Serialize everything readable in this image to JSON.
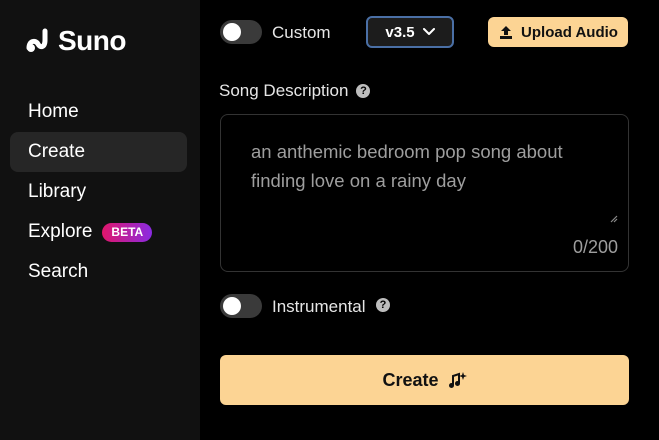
{
  "brand": {
    "name": "Suno"
  },
  "sidebar": {
    "items": [
      {
        "label": "Home"
      },
      {
        "label": "Create"
      },
      {
        "label": "Library"
      },
      {
        "label": "Explore",
        "badge": "BETA"
      },
      {
        "label": "Search"
      }
    ]
  },
  "form": {
    "custom_toggle_label": "Custom",
    "version": "v3.5",
    "upload_label": "Upload Audio",
    "description_label": "Song Description",
    "description_placeholder": "an anthemic bedroom pop song about finding love on a rainy day",
    "char_count": "0/200",
    "instrumental_label": "Instrumental",
    "create_label": "Create"
  },
  "colors": {
    "accent": "#fcd494",
    "sidebar_bg": "#111111",
    "active_bg": "#262626",
    "badge_gradient_start": "#e0166b",
    "badge_gradient_end": "#8a2be2",
    "select_border": "#4a6fa5"
  },
  "icons": {
    "logo": "suno-wave-logo",
    "chevron": "chevron-down-icon",
    "upload": "upload-icon",
    "help": "question-mark-icon",
    "create": "music-sparkle-icon"
  }
}
